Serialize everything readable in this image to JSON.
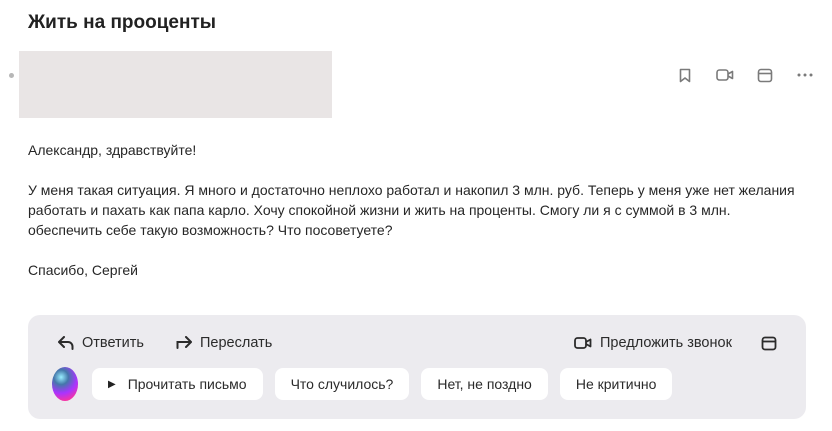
{
  "email": {
    "subject": "Жить на прооценты",
    "body": [
      "Александр, здравствуйте!",
      "У меня такая ситуация. Я много и достаточно неплохо работал и накопил 3 млн. руб. Теперь у меня уже нет желания работать и пахать как папа карло. Хочу спокойной жизни и жить на проценты. Смогу ли я с суммой в 3 млн. обеспечить себе такую возможность? Что посоветуете?",
      "Спасибо, Сергей"
    ]
  },
  "toolbar_icons": [
    "bookmark-icon",
    "video-call-icon",
    "calendar-icon",
    "more-icon"
  ],
  "actions": {
    "reply": "Ответить",
    "forward": "Переслать",
    "suggest_call": "Предложить звонок"
  },
  "quick_replies": {
    "read": "Прочитать письмо",
    "what_happened": "Что случилось?",
    "not_late": "Нет, не поздно",
    "not_critical": "Не критично"
  },
  "colors": {
    "panel_bg": "#ecebef",
    "redacted_block": "#e9e5e5",
    "icon_grey": "#7a7a7a"
  }
}
